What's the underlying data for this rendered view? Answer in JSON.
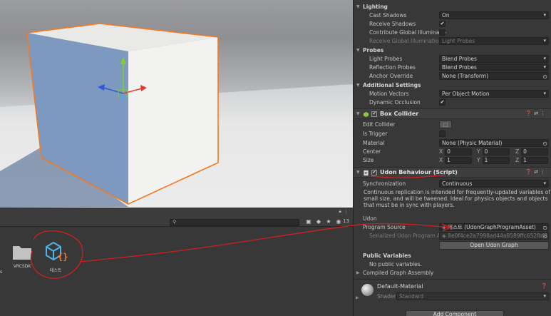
{
  "inspector": {
    "lighting": {
      "header": "Lighting",
      "cast_shadows_label": "Cast Shadows",
      "cast_shadows_value": "On",
      "receive_shadows_label": "Receive Shadows",
      "contribute_gi_label": "Contribute Global Illuminatio",
      "receive_gi_label": "Receive Global Illumination",
      "receive_gi_value": "Light Probes"
    },
    "probes": {
      "header": "Probes",
      "light_probes_label": "Light Probes",
      "light_probes_value": "Blend Probes",
      "reflection_probes_label": "Reflection Probes",
      "reflection_probes_value": "Blend Probes",
      "anchor_override_label": "Anchor Override",
      "anchor_override_value": "None (Transform)"
    },
    "additional": {
      "header": "Additional Settings",
      "motion_vectors_label": "Motion Vectors",
      "motion_vectors_value": "Per Object Motion",
      "dynamic_occlusion_label": "Dynamic Occlusion"
    },
    "box_collider": {
      "title": "Box Collider",
      "edit_collider_label": "Edit Collider",
      "is_trigger_label": "Is Trigger",
      "material_label": "Material",
      "material_value": "None (Physic Material)",
      "center_label": "Center",
      "center": {
        "x": "0",
        "y": "0",
        "z": "0"
      },
      "size_label": "Size",
      "size": {
        "x": "1",
        "y": "1",
        "z": "1"
      }
    },
    "udon": {
      "title": "Udon Behaviour (Script)",
      "sync_label": "Synchronization",
      "sync_value": "Continuous",
      "sync_description": "Continuous replication is intended for frequently-updated variables of small size, and will be tweened. Ideal for physics objects and objects that must be in sync with players.",
      "udon_section": "Udon",
      "program_source_label": "Program Source",
      "program_source_value": "테스트 (UdonGraphProgramAsset)",
      "serialized_label": "Serialized Udon Program Ass",
      "serialized_value": "8e0f4ce2a7998ad44a8589ffc652fbf8 (S",
      "open_graph_button": "Open Udon Graph",
      "public_vars_header": "Public Variables",
      "no_public_vars": "No public variables.",
      "compiled_assembly": "Compiled Graph Assembly"
    },
    "material": {
      "name": "Default-Material",
      "shader_label": "Shader",
      "shader_value": "Standard"
    },
    "add_component_button": "Add Component"
  },
  "scene": {
    "accent": "#f5781e"
  },
  "project": {
    "item_count": "13",
    "assets": [
      {
        "name": "VRCSDK",
        "icon": "folder-icon"
      },
      {
        "name": "테스트",
        "icon": "udon-graph-asset-icon"
      }
    ],
    "left_partial_label": "s"
  }
}
